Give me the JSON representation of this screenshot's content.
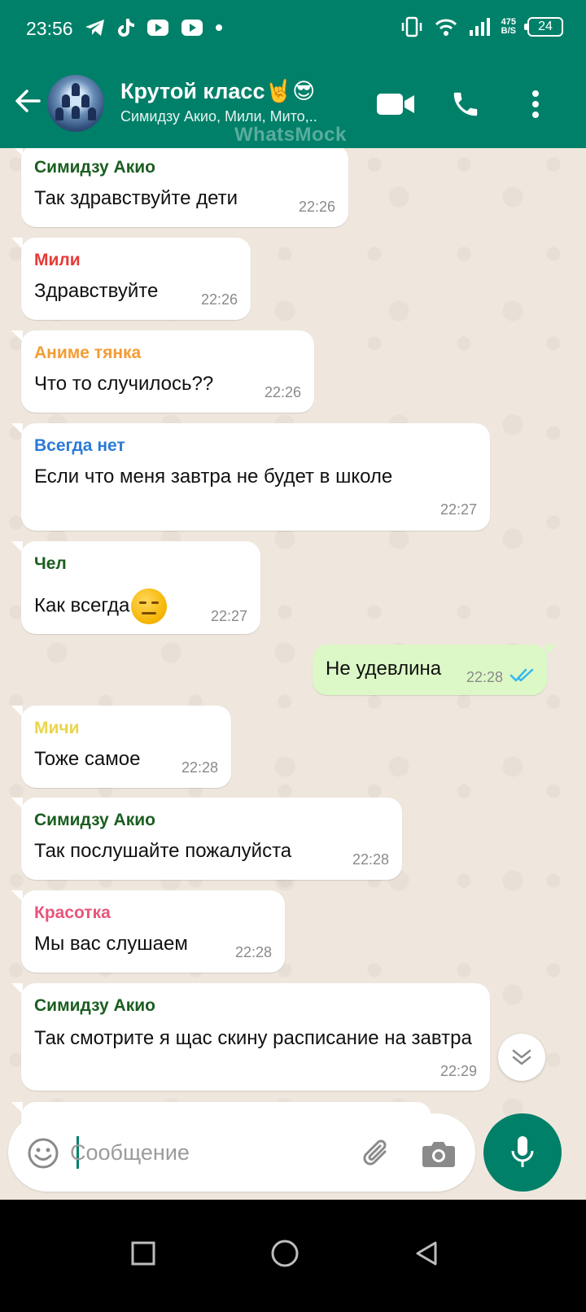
{
  "status_bar": {
    "time": "23:56",
    "net_speed_value": "475",
    "net_speed_unit": "B/S",
    "battery": "24"
  },
  "header": {
    "title": "Крутой класс🤘😎",
    "subtitle": "Симидзу Акио, Мили, Мито,..",
    "watermark": "WhatsMock"
  },
  "messages": [
    {
      "sender": "Симидзу Акио",
      "sender_color": "#1b5e20",
      "text": "Так здравствуйте дети",
      "time": "22:26"
    },
    {
      "sender": "Мили",
      "sender_color": "#e53935",
      "text": "Здравствуйте",
      "time": "22:26"
    },
    {
      "sender": "Аниме тянка",
      "sender_color": "#f39c34",
      "text": "Что то случилось??",
      "time": "22:26"
    },
    {
      "sender": "Всегда нет",
      "sender_color": "#2b7bd6",
      "text": "Если что меня завтра не будет в школе",
      "time": "22:27"
    },
    {
      "sender": "Чел",
      "sender_color": "#1b5e20",
      "text": "Как всегда",
      "time": "22:27"
    },
    {
      "sender": "",
      "text": "Не удевлина",
      "time": "22:28",
      "outgoing": true
    },
    {
      "sender": "Мичи",
      "sender_color": "#e9d548",
      "text": "Тоже самое",
      "time": "22:28"
    },
    {
      "sender": "Симидзу Акио",
      "sender_color": "#1b5e20",
      "text": "Так послушайте пожалуйста",
      "time": "22:28"
    },
    {
      "sender": "Красотка",
      "sender_color": "#e8557a",
      "text": "Мы вас слушаем",
      "time": "22:28"
    },
    {
      "sender": "Симидзу Акио",
      "sender_color": "#1b5e20",
      "text": "Так смотрите я щас скину расписание на завтра",
      "time": "22:29"
    }
  ],
  "composer": {
    "placeholder": "Сообщение"
  },
  "colors": {
    "accent": "#008069",
    "outgoing_bubble": "#dcf8c6",
    "read_ticks": "#34b7f1"
  },
  "icons": [
    "back-arrow-icon",
    "video-call-icon",
    "voice-call-icon",
    "more-options-icon",
    "emoji-icon",
    "attach-icon",
    "camera-icon",
    "mic-icon",
    "scroll-down-icon",
    "double-check-icon"
  ]
}
